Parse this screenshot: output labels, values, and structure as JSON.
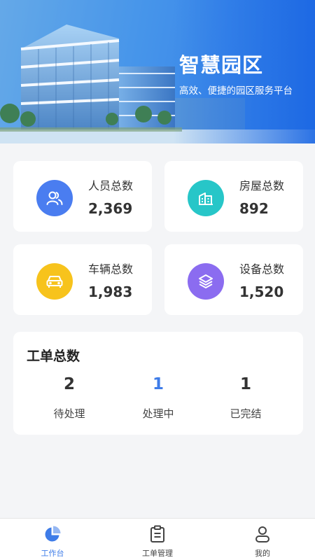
{
  "banner": {
    "title": "智慧园区",
    "subtitle": "高效、便捷的园区服务平台"
  },
  "stats": [
    {
      "label": "人员总数",
      "value": "2,369",
      "icon": "people-icon",
      "color": "#4a7df0"
    },
    {
      "label": "房屋总数",
      "value": "892",
      "icon": "building-icon",
      "color": "#27c6c8"
    },
    {
      "label": "车辆总数",
      "value": "1,983",
      "icon": "car-icon",
      "color": "#f7c31c"
    },
    {
      "label": "设备总数",
      "value": "1,520",
      "icon": "layers-icon",
      "color": "#8b6cf0"
    }
  ],
  "work_orders": {
    "title": "工单总数",
    "items": [
      {
        "count": "2",
        "label": "待处理",
        "color": "#333333"
      },
      {
        "count": "1",
        "label": "处理中",
        "color": "#3e7ce8"
      },
      {
        "count": "1",
        "label": "已完结",
        "color": "#333333"
      }
    ]
  },
  "tabbar": {
    "active_color": "#3e7ce8",
    "items": [
      {
        "label": "工作台",
        "icon": "pie-chart-icon",
        "active": true
      },
      {
        "label": "工单管理",
        "icon": "clipboard-icon",
        "active": false
      },
      {
        "label": "我的",
        "icon": "user-icon",
        "active": false
      }
    ]
  }
}
